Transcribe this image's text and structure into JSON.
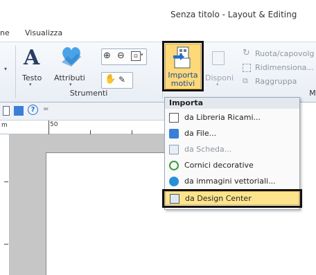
{
  "window": {
    "title": "Senza titolo - Layout & Editing"
  },
  "tabs": [
    {
      "label": "ne"
    },
    {
      "label": "Visualizza"
    }
  ],
  "ribbon": {
    "testo_label": "Testo",
    "attributi_label": "Attributi",
    "strumenti_label": "Strumenti",
    "importa_label_1": "Importa",
    "importa_label_2": "motivi",
    "disponi_label": "Disponi",
    "ruota_label": "Ruota/capovolg",
    "ridimensiona_label": "Ridimensiona...",
    "raggruppa_label": "Raggruppa",
    "group_m_label": "M"
  },
  "doc_toolbar": {
    "help_glyph": "?",
    "more_glyph": "="
  },
  "ruler": {
    "unit_mark": "m",
    "mark_50": "50"
  },
  "colors": {
    "accent": "#1e6fd0",
    "highlight": "#fde48c",
    "heart": "#4aa3e8"
  },
  "import_menu": {
    "header": "Importa",
    "items": [
      {
        "label": "da Libreria Ricami...",
        "icon": "library-icon",
        "disabled": false
      },
      {
        "label": "da File...",
        "icon": "folder-icon",
        "disabled": false
      },
      {
        "label": "da Scheda...",
        "icon": "card-icon",
        "disabled": true
      },
      {
        "label": "Cornici decorative",
        "icon": "frame-icon",
        "disabled": false
      },
      {
        "label": "da immagini vettoriali...",
        "icon": "vector-icon",
        "disabled": false
      },
      {
        "label": "da Design Center",
        "icon": "design-center-icon",
        "disabled": false
      }
    ]
  }
}
